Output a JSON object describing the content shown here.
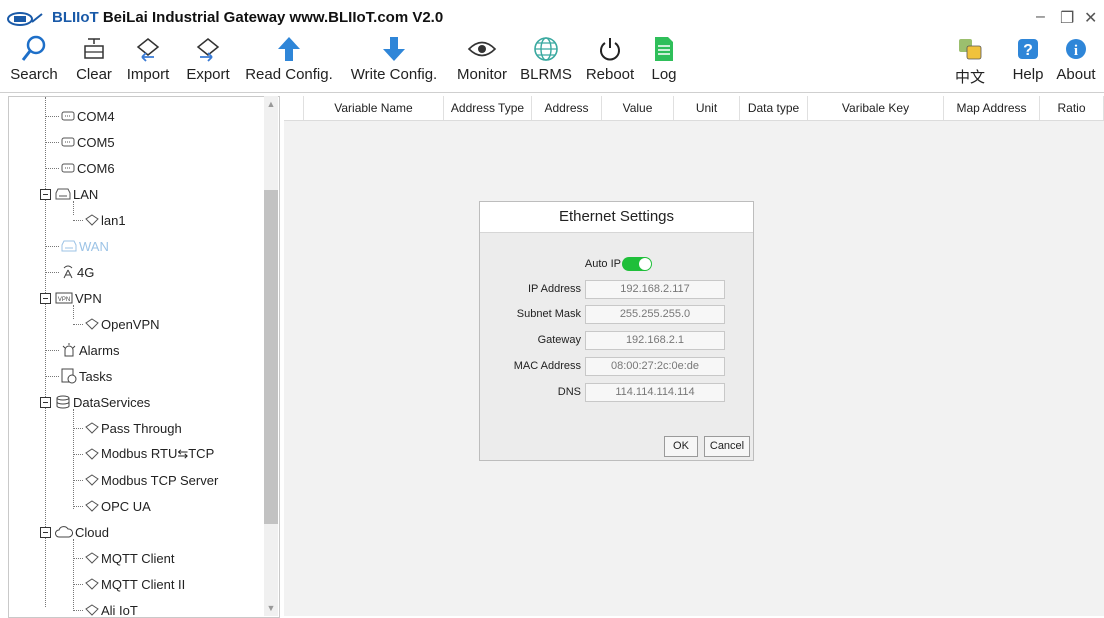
{
  "window": {
    "title_brand": "BLIIoT",
    "title_rest": " BeiLai Industrial Gateway www.BLIIoT.com V2.0",
    "logo_icon": "bliiot-logo-icon",
    "controls": {
      "minimize": "–",
      "restore": "❐",
      "close": "✕"
    }
  },
  "toolbar": {
    "search": "Search",
    "clear": "Clear",
    "import": "Import",
    "export": "Export",
    "read_config": "Read Config.",
    "write_config": "Write Config.",
    "monitor": "Monitor",
    "blrms": "BLRMS",
    "reboot": "Reboot",
    "log": "Log",
    "language": "中文",
    "help": "Help",
    "about": "About"
  },
  "tree": {
    "items": [
      {
        "label": "COM4",
        "icon": "serial-port-icon"
      },
      {
        "label": "COM5",
        "icon": "serial-port-icon"
      },
      {
        "label": "COM6",
        "icon": "serial-port-icon"
      },
      {
        "label": "LAN",
        "icon": "network-icon"
      },
      {
        "label": "lan1",
        "icon": "node-icon"
      },
      {
        "label": "WAN",
        "icon": "network-icon"
      },
      {
        "label": "4G",
        "icon": "antenna-icon"
      },
      {
        "label": "VPN",
        "icon": "vpn-icon"
      },
      {
        "label": "OpenVPN",
        "icon": "node-icon"
      },
      {
        "label": "Alarms",
        "icon": "alarm-icon"
      },
      {
        "label": "Tasks",
        "icon": "tasks-icon"
      },
      {
        "label": "DataServices",
        "icon": "database-icon"
      },
      {
        "label": "Pass Through",
        "icon": "node-icon"
      },
      {
        "label": "Modbus RTU⇆TCP",
        "icon": "node-icon"
      },
      {
        "label": "Modbus TCP Server",
        "icon": "node-icon"
      },
      {
        "label": "OPC UA",
        "icon": "node-icon"
      },
      {
        "label": "Cloud",
        "icon": "cloud-icon"
      },
      {
        "label": "MQTT Client",
        "icon": "node-icon"
      },
      {
        "label": "MQTT Client II",
        "icon": "node-icon"
      },
      {
        "label": "Ali IoT",
        "icon": "node-icon"
      }
    ]
  },
  "grid": {
    "columns": [
      "Variable Name",
      "Address Type",
      "Address",
      "Value",
      "Unit",
      "Data type",
      "Varibale Key",
      "Map Address",
      "Ratio"
    ]
  },
  "dialog": {
    "title": "Ethernet Settings",
    "auto_ip_label": "Auto IP",
    "auto_ip_on": true,
    "fields": [
      {
        "label": "IP Address",
        "value": "192.168.2.117"
      },
      {
        "label": "Subnet Mask",
        "value": "255.255.255.0"
      },
      {
        "label": "Gateway",
        "value": "192.168.2.1"
      },
      {
        "label": "MAC Address",
        "value": "08:00:27:2c:0e:de"
      },
      {
        "label": "DNS",
        "value": "114.114.114.114"
      }
    ],
    "ok": "OK",
    "cancel": "Cancel"
  },
  "colors": {
    "accent": "#1a5aa8",
    "toggle_on": "#1fbf3a",
    "disabled_text": "#9cc3e6"
  }
}
